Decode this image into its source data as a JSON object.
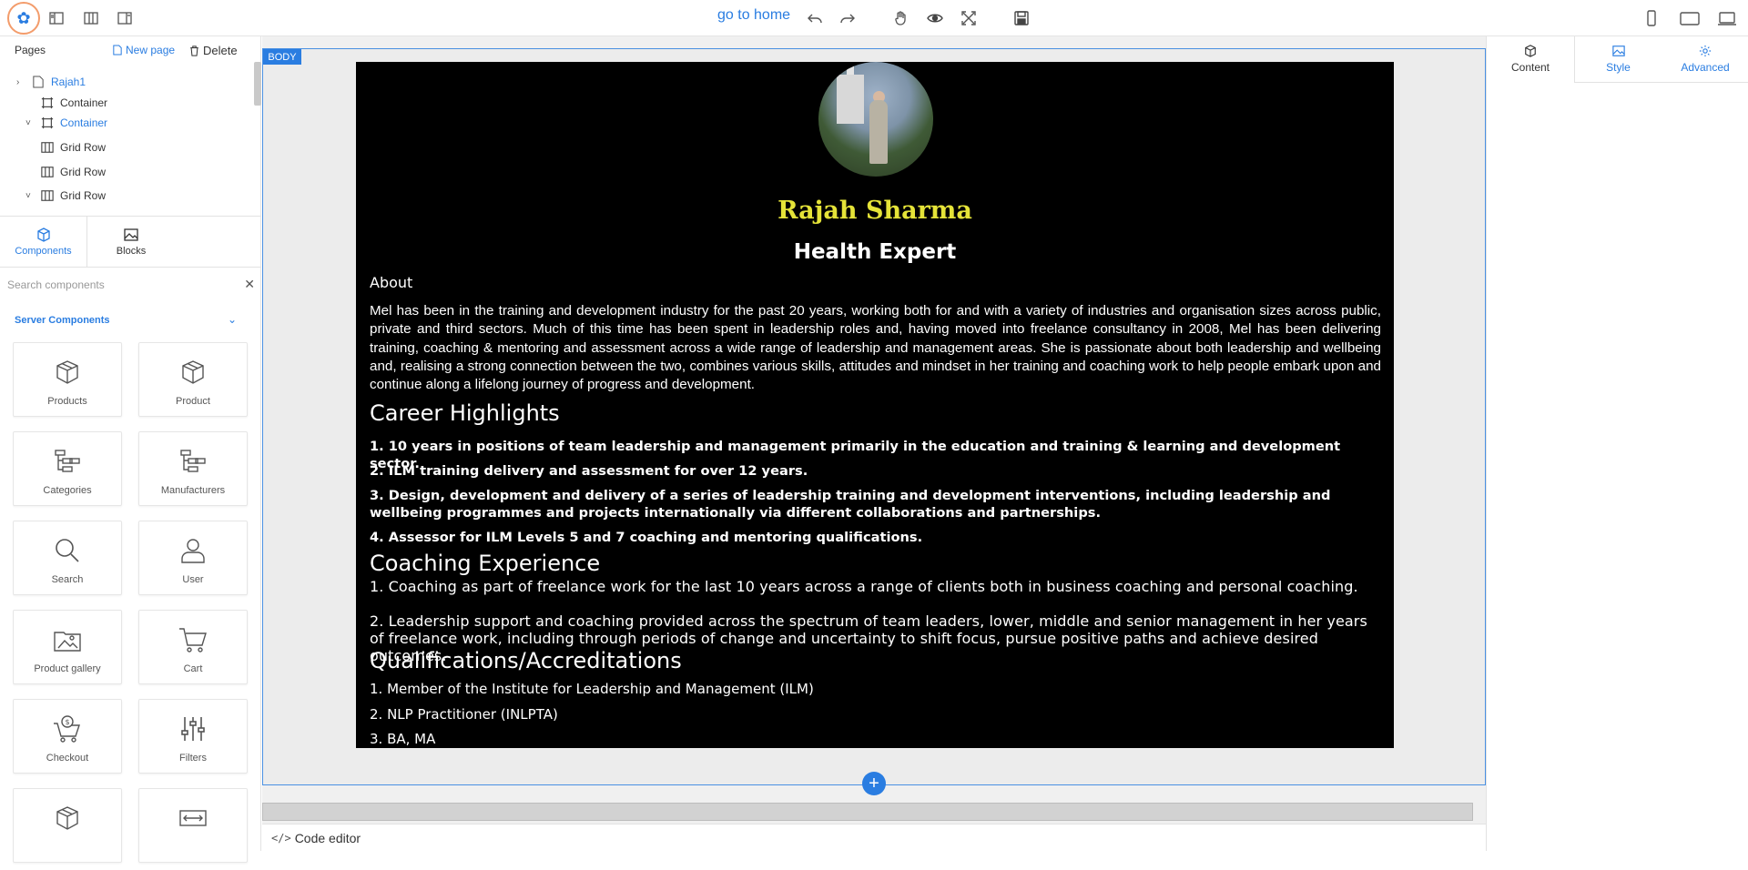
{
  "toolbar": {
    "go_home": "go to home",
    "icons": [
      "layout-sidebar-icon",
      "layout-columns-icon",
      "layout-split-icon",
      "undo-icon",
      "redo-icon",
      "hand-icon",
      "eye-icon",
      "fullscreen-icon",
      "save-icon",
      "mobile-icon",
      "tablet-icon",
      "desktop-icon"
    ]
  },
  "pages": {
    "title": "Pages",
    "new_page": "New page",
    "delete": "Delete",
    "tree": [
      {
        "label": "Rajah1",
        "icon": "page-icon",
        "selected": true
      },
      {
        "label": "Container",
        "icon": "container-icon",
        "selected": false
      },
      {
        "label": "Container",
        "icon": "container-icon",
        "selected": true
      },
      {
        "label": "Grid Row",
        "icon": "grid-row-icon",
        "selected": false
      },
      {
        "label": "Grid Row",
        "icon": "grid-row-icon",
        "selected": false
      },
      {
        "label": "Grid Row",
        "icon": "grid-row-icon",
        "selected": false
      }
    ]
  },
  "panel_tabs": [
    {
      "label": "Components",
      "active": true
    },
    {
      "label": "Blocks",
      "active": false
    }
  ],
  "search": {
    "placeholder": "Search components"
  },
  "server_components": {
    "title": "Server Components",
    "items": [
      {
        "label": "Products",
        "icon": "box-icon"
      },
      {
        "label": "Product",
        "icon": "box-icon"
      },
      {
        "label": "Categories",
        "icon": "categories-icon"
      },
      {
        "label": "Manufacturers",
        "icon": "manufacturers-icon"
      },
      {
        "label": "Search",
        "icon": "search-icon"
      },
      {
        "label": "User",
        "icon": "user-icon"
      },
      {
        "label": "Product gallery",
        "icon": "gallery-icon"
      },
      {
        "label": "Cart",
        "icon": "cart-icon"
      },
      {
        "label": "Checkout",
        "icon": "checkout-icon"
      },
      {
        "label": "Filters",
        "icon": "filters-icon"
      },
      {
        "label": "",
        "icon": "box-icon"
      },
      {
        "label": "",
        "icon": "divider-icon"
      }
    ]
  },
  "canvas": {
    "body_tag": "BODY",
    "profile": {
      "name": "Rajah Sharma",
      "role": "Health Expert",
      "about_heading": "About",
      "about_text": "Mel has been in the training and development industry for the past 20 years, working both for and with a variety of industries and organisation sizes across public, private and third sectors. Much of this time has been spent in leadership roles and, having moved into freelance consultancy in 2008, Mel has been delivering training, coaching & mentoring and assessment across a wide range of leadership and management areas. She is passionate about both leadership and wellbeing and, realising a strong connection between the two, combines various skills, attitudes and mindset in her training and coaching work to help people embark upon and continue along a lifelong journey of progress and development.",
      "career_heading": "Career Highlights",
      "career_items": [
        "1. 10 years in positions of team leadership and management primarily in the education and training & learning and development sector.",
        "2. ILM training delivery and assessment for over 12 years.",
        "3. Design, development and delivery of a series of leadership training and development interventions, including leadership and wellbeing programmes and projects internationally via different collaborations and partnerships.",
        "4. Assessor for ILM Levels 5 and 7 coaching and mentoring qualifications."
      ],
      "coaching_heading": "Coaching Experience",
      "coaching_items": [
        "1. Coaching as part of freelance work for the last 10 years across a range of clients both in business coaching and personal coaching.",
        "2. Leadership support and coaching provided across the spectrum of team leaders, lower, middle and senior management in her years of freelance work, including through periods of change and uncertainty to shift focus, pursue positive paths and achieve desired outcomes."
      ],
      "qual_heading": "Qualifications/Accreditations",
      "qual_items": [
        "1. Member of the Institute for Leadership and Management (ILM)",
        "2. NLP Practitioner (INLPTA)",
        "3. BA, MA"
      ]
    }
  },
  "code_editor": "Code editor",
  "right_tabs": [
    {
      "label": "Content",
      "active": false
    },
    {
      "label": "Style",
      "active": true
    },
    {
      "label": "Advanced",
      "active": true
    }
  ],
  "colors": {
    "accent": "#2a7de1",
    "name_yellow": "#e5e338",
    "page_bg": "#000000"
  }
}
